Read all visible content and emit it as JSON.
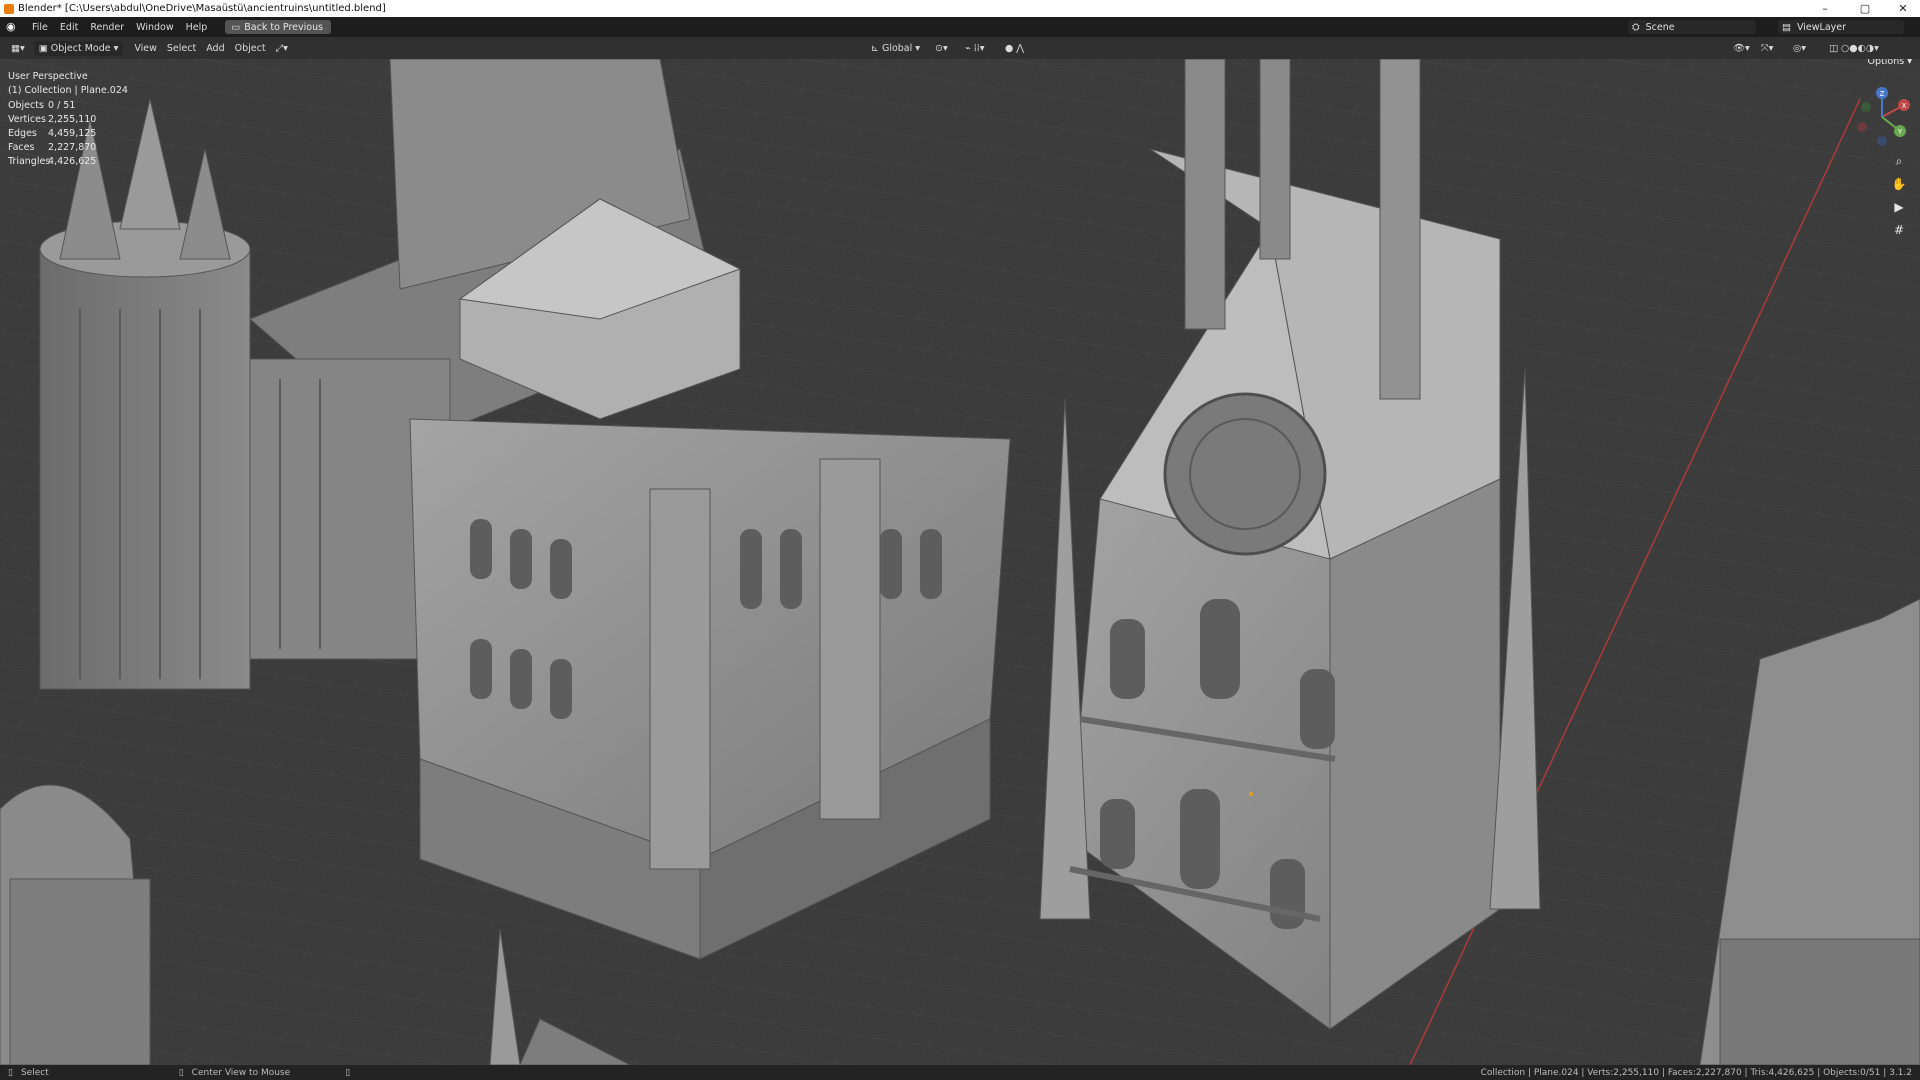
{
  "window": {
    "title": "Blender* [C:\\Users\\abdul\\OneDrive\\Masaüstü\\ancientruins\\untitled.blend]",
    "controls": [
      "–",
      "▢",
      "✕"
    ]
  },
  "menubar": {
    "items": [
      "File",
      "Edit",
      "Render",
      "Window",
      "Help"
    ],
    "back_button": "Back to Previous",
    "scene": "Scene",
    "view_layer": "ViewLayer"
  },
  "header": {
    "mode": "Object Mode",
    "menus": [
      "View",
      "Select",
      "Add",
      "Object"
    ],
    "orientation": "Global",
    "options": "Options"
  },
  "viewport": {
    "perspective": "User Perspective",
    "collection": "(1) Collection | Plane.024",
    "stats": [
      {
        "label": "Objects",
        "value": "0 / 51"
      },
      {
        "label": "Vertices",
        "value": "2,255,110"
      },
      {
        "label": "Edges",
        "value": "4,459,125"
      },
      {
        "label": "Faces",
        "value": "2,227,870"
      },
      {
        "label": "Triangles",
        "value": "4,426,625"
      }
    ],
    "gizmo_axes": [
      "X",
      "Y",
      "Z"
    ],
    "nav_tools": [
      "zoom-icon",
      "hand-pan-icon",
      "camera-icon",
      "grid-ortho-icon"
    ]
  },
  "statusbar": {
    "left": "Select",
    "middle": "Center View to Mouse",
    "right": "Collection | Plane.024 | Verts:2,255,110 | Faces:2,227,870 | Tris:4,426,625 | Objects:0/51 | 3.1.2"
  },
  "colors": {
    "background": "#3a3a3a",
    "grid": "#454545",
    "x_axis": "#b03a3a",
    "header": "#303030",
    "menubar": "#1d1d1d",
    "model": "#8e8e8e"
  }
}
